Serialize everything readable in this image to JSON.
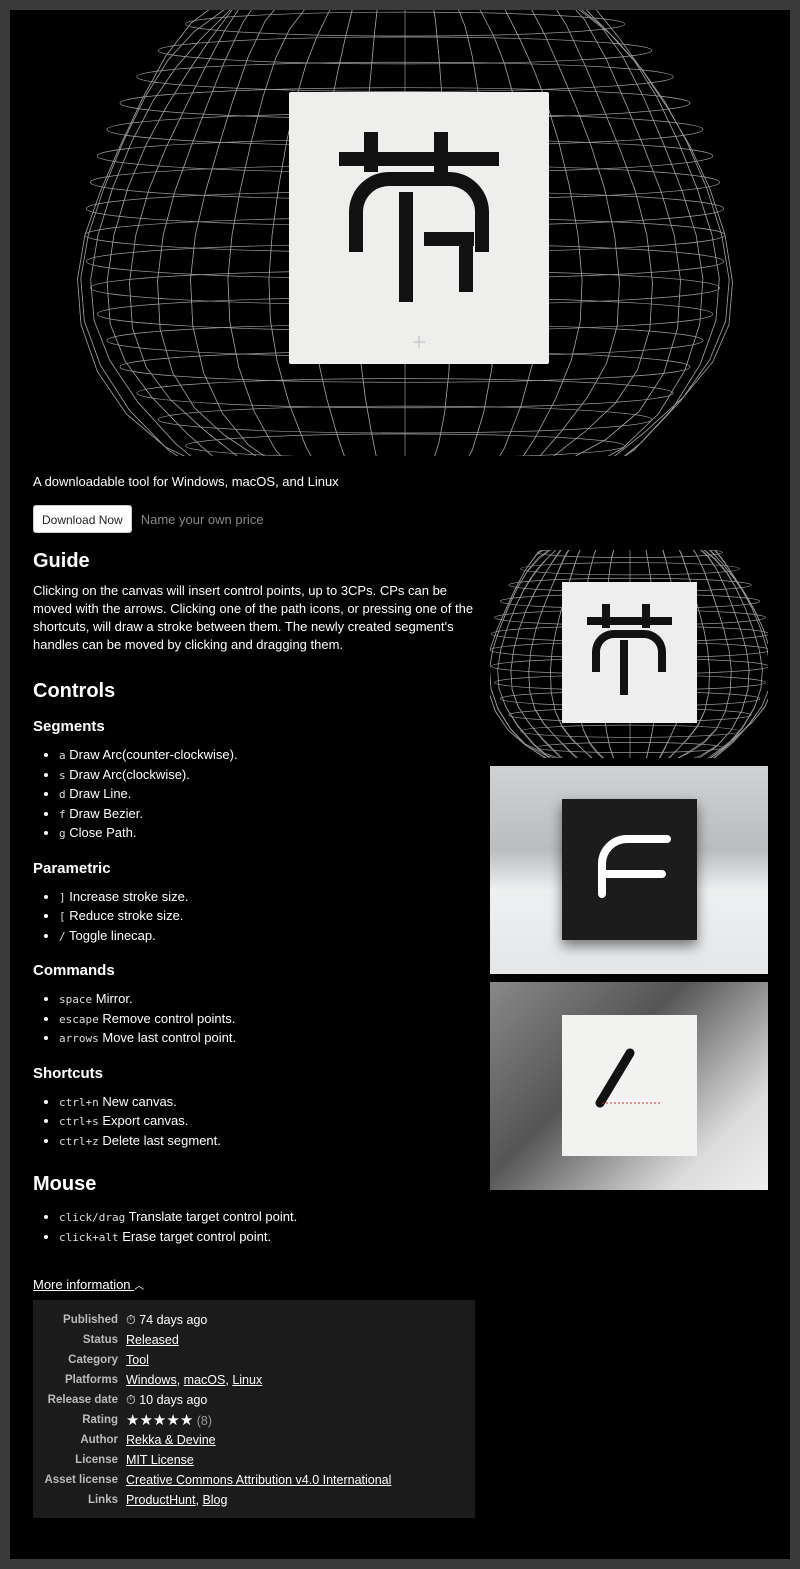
{
  "tagline": "A downloadable tool for Windows, macOS, and Linux",
  "buy": {
    "download_label": "Download Now",
    "price_label": "Name your own price"
  },
  "guide": {
    "title": "Guide",
    "text": "Clicking on the canvas will insert control points, up to 3CPs. CPs can be moved with the arrows. Clicking one of the path icons, or pressing one of the shortcuts, will draw a stroke between them. The newly created segment's handles can be moved by clicking and dragging them."
  },
  "controls": {
    "title": "Controls",
    "sections": [
      {
        "title": "Segments",
        "items": [
          {
            "key": "a",
            "text": "Draw Arc(counter-clockwise)."
          },
          {
            "key": "s",
            "text": "Draw Arc(clockwise)."
          },
          {
            "key": "d",
            "text": "Draw Line."
          },
          {
            "key": "f",
            "text": "Draw Bezier."
          },
          {
            "key": "g",
            "text": "Close Path."
          }
        ]
      },
      {
        "title": "Parametric",
        "items": [
          {
            "key": "]",
            "text": "Increase stroke size."
          },
          {
            "key": "[",
            "text": "Reduce stroke size."
          },
          {
            "key": "/",
            "text": "Toggle linecap."
          }
        ]
      },
      {
        "title": "Commands",
        "items": [
          {
            "key": "space",
            "text": "Mirror."
          },
          {
            "key": "escape",
            "text": "Remove control points."
          },
          {
            "key": "arrows",
            "text": "Move last control point."
          }
        ]
      },
      {
        "title": "Shortcuts",
        "items": [
          {
            "key": "ctrl+n",
            "text": "New canvas."
          },
          {
            "key": "ctrl+s",
            "text": "Export canvas."
          },
          {
            "key": "ctrl+z",
            "text": "Delete last segment."
          }
        ]
      }
    ]
  },
  "mouse": {
    "title": "Mouse",
    "items": [
      {
        "key": "click/drag",
        "text": "Translate target control point."
      },
      {
        "key": "click+alt",
        "text": "Erase target control point."
      }
    ]
  },
  "more_info": {
    "toggle_label": "More information",
    "published_label": "Published",
    "published": "74 days ago",
    "status_label": "Status",
    "status": "Released",
    "category_label": "Category",
    "category": "Tool",
    "platforms_label": "Platforms",
    "platforms": [
      "Windows",
      "macOS",
      "Linux"
    ],
    "release_label": "Release date",
    "release": "10 days ago",
    "rating_label": "Rating",
    "rating": 5,
    "rating_count": "(8)",
    "author_label": "Author",
    "author": "Rekka & Devine",
    "license_label": "License",
    "license": "MIT License",
    "asset_license_label": "Asset license",
    "asset_license": "Creative Commons Attribution v4.0 International",
    "links_label": "Links",
    "links": [
      "ProductHunt",
      "Blog"
    ]
  }
}
